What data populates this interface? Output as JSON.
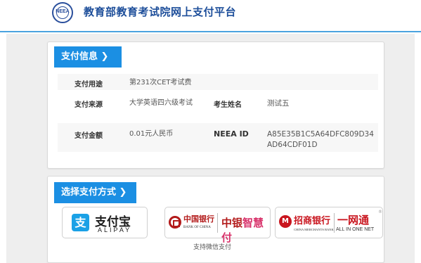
{
  "header": {
    "logo_text": "NEEA",
    "site_title": "教育部教育考试院网上支付平台"
  },
  "payment_info": {
    "section_title": "支付信息 ❯",
    "rows": [
      {
        "label": "支付用途",
        "value": "第231次CET考试费"
      },
      {
        "label": "支付来源",
        "value": "大学英语四六级考试",
        "label2": "考生姓名",
        "value2": "测试五"
      },
      {
        "label": "支付金额",
        "value": "0.01元人民币",
        "label2": "NEEA ID",
        "value2": "A85E35B1C5A64DFC809D34AD64CDF01D"
      }
    ]
  },
  "payment_method": {
    "section_title": "选择支付方式 ❯",
    "alipay": {
      "icon": "支",
      "cn": "支付宝",
      "en": "ALIPAY"
    },
    "boc": {
      "name": "中国银行",
      "en": "BANK OF CHINA",
      "unionpay_a": "中银",
      "unionpay_b": "智慧付"
    },
    "cmb": {
      "icon": "M",
      "name": "招商银行",
      "en": "CHINA MERCHANTS BANK",
      "onenet": "一网通",
      "onenet_en": "ALL IN ONE NET",
      "reg": "®"
    },
    "wechat_note": "支持微信支付"
  },
  "colors": {
    "accent": "#1b8fe3",
    "title": "#1d4e9a",
    "bank_red": "#b31b1b",
    "cmb_red": "#c9151e"
  }
}
